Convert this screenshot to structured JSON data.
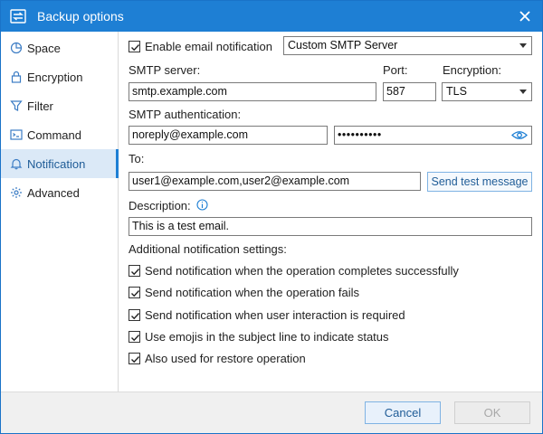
{
  "window": {
    "title": "Backup options",
    "accent": "#1e7fd4"
  },
  "sidebar": {
    "items": [
      {
        "label": "Space",
        "icon": "pie-chart-icon"
      },
      {
        "label": "Encryption",
        "icon": "lock-icon"
      },
      {
        "label": "Filter",
        "icon": "filter-icon"
      },
      {
        "label": "Command",
        "icon": "terminal-icon"
      },
      {
        "label": "Notification",
        "icon": "bell-icon",
        "active": true
      },
      {
        "label": "Advanced",
        "icon": "gear-icon"
      }
    ]
  },
  "notification": {
    "enable_label": "Enable email notification",
    "enable_checked": true,
    "server_type": "Custom SMTP Server",
    "smtp_server_label": "SMTP server:",
    "smtp_server_value": "smtp.example.com",
    "port_label": "Port:",
    "port_value": "587",
    "encryption_label": "Encryption:",
    "encryption_value": "TLS",
    "auth_label": "SMTP authentication:",
    "auth_user": "noreply@example.com",
    "auth_password_mask": "••••••••••",
    "to_label": "To:",
    "to_value": "user1@example.com,user2@example.com",
    "send_test_label": "Send test message",
    "description_label": "Description:",
    "description_value": "This is a test email.",
    "additional_label": "Additional notification settings:",
    "options": [
      {
        "label": "Send notification when the operation completes successfully",
        "checked": true
      },
      {
        "label": "Send notification when the operation fails",
        "checked": true
      },
      {
        "label": "Send notification when user interaction is required",
        "checked": true
      },
      {
        "label": "Use emojis in the subject line to indicate status",
        "checked": true
      },
      {
        "label": "Also used for restore operation",
        "checked": true
      }
    ]
  },
  "footer": {
    "cancel_label": "Cancel",
    "ok_label": "OK"
  }
}
